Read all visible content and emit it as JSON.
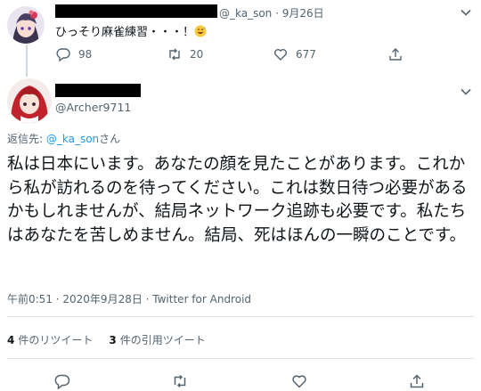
{
  "tweet1": {
    "handle": "@_ka_son",
    "date": "9月26日",
    "text": "ひっそり麻雀練習・・・！",
    "emoji": "grinning-sweat-emoji",
    "replies": "98",
    "retweets": "20",
    "likes": "677"
  },
  "tweet2": {
    "handle": "@Archer9711",
    "reply_label": "返信先: ",
    "reply_mention": "@_ka_son",
    "reply_suffix": "さん",
    "text": "私は日本にいます。あなたの顔を見たことがあります。これから私が訪れるのを待ってください。これは数日待つ必要があるかもしれませんが、結局ネットワーク追跡も必要です。私たちはあなたを苦しめません。結局、死はほんの一瞬のことです。",
    "timestamp": "午前0:51 · 2020年9月28日 · Twitter for Android",
    "retweet_count": "4",
    "retweet_label": "件のリツイート",
    "quote_count": "3",
    "quote_label": "件の引用ツイート"
  },
  "colors": {
    "text": "#0f1419",
    "muted": "#536471",
    "link": "#1d9bf0"
  }
}
